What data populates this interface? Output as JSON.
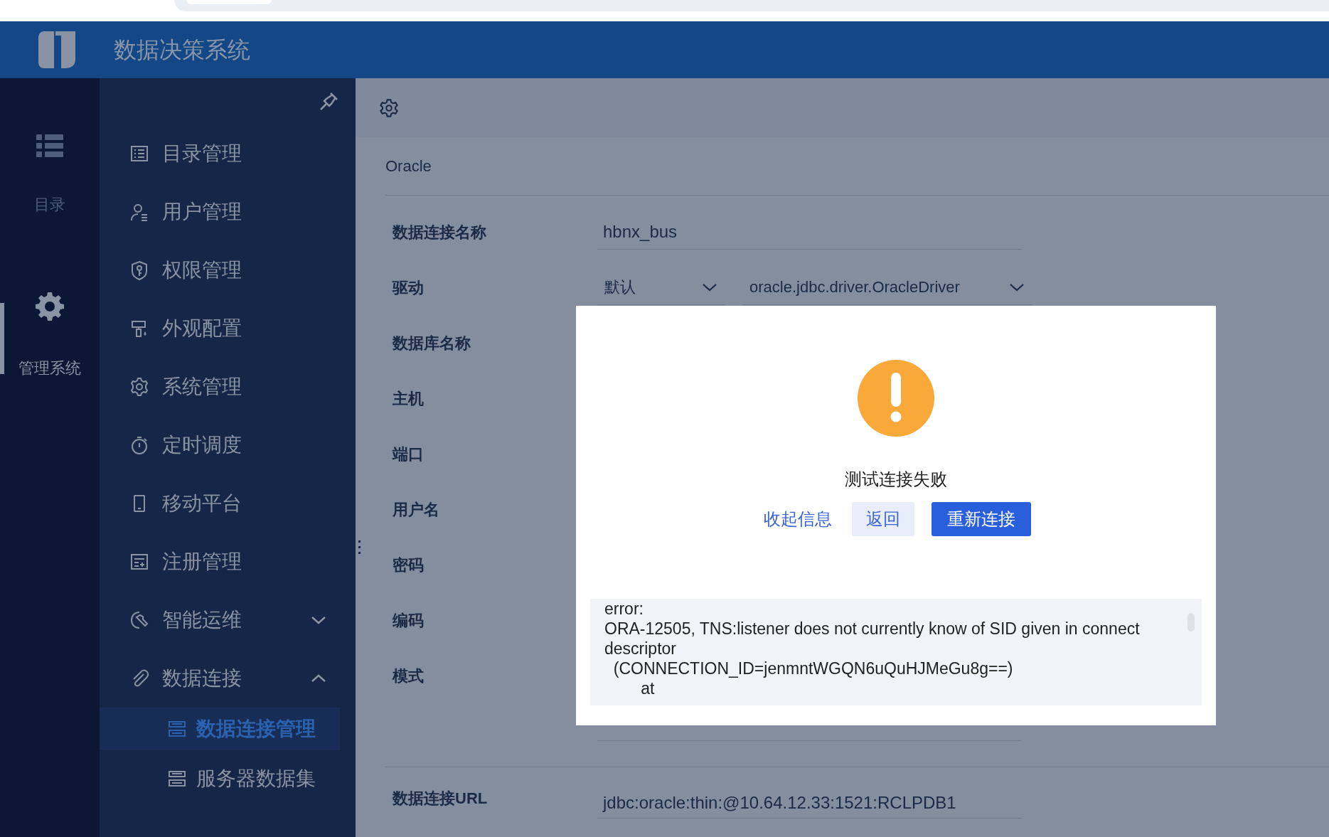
{
  "header": {
    "title": "数据决策系统"
  },
  "rail": [
    {
      "label": "目录",
      "selected": false
    },
    {
      "label": "管理系统",
      "selected": true
    }
  ],
  "menu": [
    {
      "label": "目录管理",
      "kind": "link"
    },
    {
      "label": "用户管理",
      "kind": "link"
    },
    {
      "label": "权限管理",
      "kind": "link"
    },
    {
      "label": "外观配置",
      "kind": "link"
    },
    {
      "label": "系统管理",
      "kind": "link"
    },
    {
      "label": "定时调度",
      "kind": "link"
    },
    {
      "label": "移动平台",
      "kind": "link"
    },
    {
      "label": "注册管理",
      "kind": "link"
    },
    {
      "label": "智能运维",
      "kind": "group",
      "expanded": false
    },
    {
      "label": "数据连接",
      "kind": "group",
      "expanded": true,
      "children": [
        {
          "label": "数据连接管理",
          "selected": true
        },
        {
          "label": "服务器数据集",
          "selected": false
        }
      ]
    }
  ],
  "form": {
    "section": "Oracle",
    "fields": [
      {
        "label": "数据连接名称",
        "kind": "text",
        "value": "hbnx_bus"
      },
      {
        "label": "驱动",
        "kind": "selects",
        "values": [
          "默认",
          "oracle.jdbc.driver.OracleDriver"
        ]
      },
      {
        "label": "数据库名称",
        "kind": "hidden"
      },
      {
        "label": "主机",
        "kind": "hidden"
      },
      {
        "label": "端口",
        "kind": "hidden"
      },
      {
        "label": "用户名",
        "kind": "hidden"
      },
      {
        "label": "密码",
        "kind": "hidden"
      },
      {
        "label": "编码",
        "kind": "hidden"
      },
      {
        "label": "模式",
        "kind": "hidden"
      }
    ],
    "url": {
      "label": "数据连接URL",
      "value": "jdbc:oracle:thin:@10.64.12.33:1521:RCLPDB1"
    }
  },
  "dialog": {
    "title": "测试连接失败",
    "buttons": [
      {
        "label": "收起信息",
        "kind": "link"
      },
      {
        "label": "返回",
        "kind": "secondary"
      },
      {
        "label": "重新连接",
        "kind": "primary"
      }
    ],
    "log": [
      "error:",
      "ORA-12505, TNS:listener does not currently know of SID given in connect descriptor",
      "  (CONNECTION_ID=jenmntWGQN6uQuHJMeGu8g==)",
      "        at"
    ]
  }
}
